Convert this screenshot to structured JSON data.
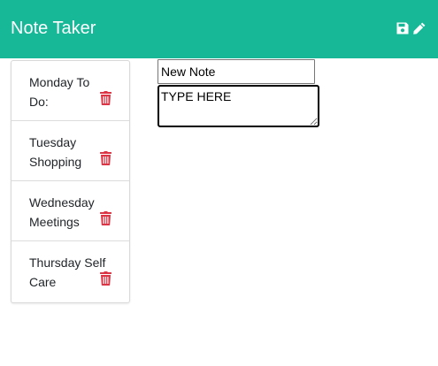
{
  "app": {
    "title": "Note Taker"
  },
  "toolbar": {
    "save_icon": "save-icon",
    "new_note_icon": "pencil-icon"
  },
  "notes": [
    {
      "title": "Monday To Do:",
      "delete_icon": "trash-icon"
    },
    {
      "title": "Tuesday Shopping",
      "delete_icon": "trash-icon"
    },
    {
      "title": "Wednesday Meetings",
      "delete_icon": "trash-icon"
    },
    {
      "title": "Thursday Self Care",
      "delete_icon": "trash-icon"
    }
  ],
  "editor": {
    "title_value": "New Note",
    "text_value": "TYPE HERE"
  },
  "colors": {
    "navbar": "#17b897",
    "delete": "#dc3545"
  }
}
